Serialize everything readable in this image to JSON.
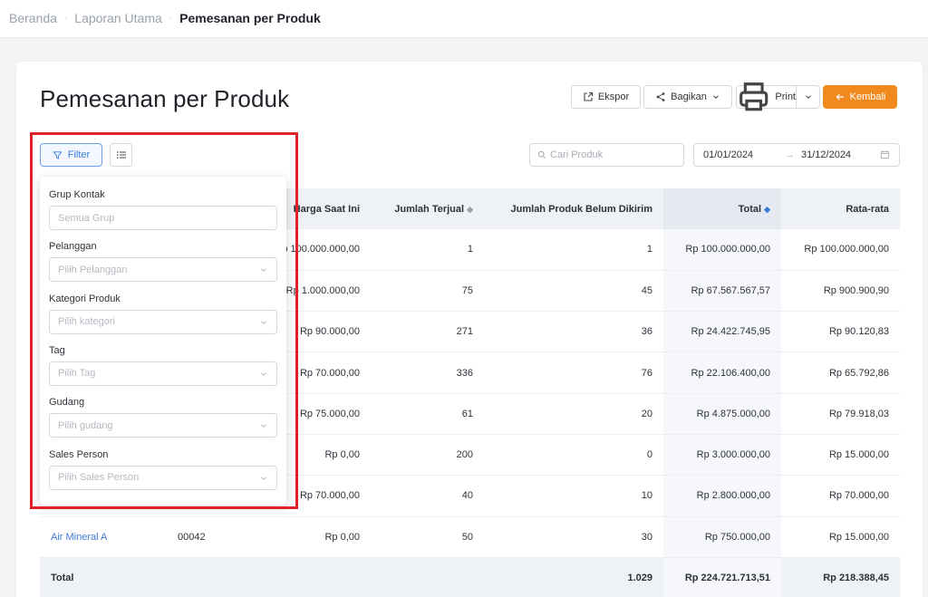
{
  "breadcrumb": {
    "items": [
      "Beranda",
      "Laporan Utama"
    ],
    "current": "Pemesanan per Produk"
  },
  "page": {
    "title": "Pemesanan per Produk"
  },
  "toolbar": {
    "export_label": "Ekspor",
    "share_label": "Bagikan",
    "print_label": "Print",
    "back_label": "Kembali"
  },
  "filter": {
    "button_label": "Filter"
  },
  "search": {
    "placeholder": "Cari Produk"
  },
  "date_range": {
    "start": "01/01/2024",
    "end": "31/12/2024",
    "arrow": "→"
  },
  "table": {
    "headers": {
      "price": "Harga Saat Ini",
      "sold": "Jumlah Terjual",
      "pending": "Jumlah Produk Belum Dikirim",
      "total": "Total",
      "average": "Rata-rata"
    },
    "rows": [
      {
        "name": "",
        "code": "",
        "price": "Rp 100.000.000,00",
        "sold": "1",
        "pending": "1",
        "total": "Rp 100.000.000,00",
        "average": "Rp 100.000.000,00"
      },
      {
        "name": "",
        "code": "",
        "price": "Rp 1.000.000,00",
        "sold": "75",
        "pending": "45",
        "total": "Rp 67.567.567,57",
        "average": "Rp 900.900,90"
      },
      {
        "name": "",
        "code": "",
        "price": "Rp 90.000,00",
        "sold": "271",
        "pending": "36",
        "total": "Rp 24.422.745,95",
        "average": "Rp 90.120,83"
      },
      {
        "name": "",
        "code": "",
        "price": "Rp 70.000,00",
        "sold": "336",
        "pending": "76",
        "total": "Rp 22.106.400,00",
        "average": "Rp 65.792,86"
      },
      {
        "name": "",
        "code": "",
        "price": "Rp 75.000,00",
        "sold": "61",
        "pending": "20",
        "total": "Rp 4.875.000,00",
        "average": "Rp 79.918,03"
      },
      {
        "name": "",
        "code": "",
        "price": "Rp 0,00",
        "sold": "200",
        "pending": "0",
        "total": "Rp 3.000.000,00",
        "average": "Rp 15.000,00"
      },
      {
        "name": "",
        "code": "",
        "price": "Rp 70.000,00",
        "sold": "40",
        "pending": "10",
        "total": "Rp 2.800.000,00",
        "average": "Rp 70.000,00"
      },
      {
        "name": "Air Mineral A",
        "code": "00042",
        "price": "Rp 0,00",
        "sold": "50",
        "pending": "30",
        "total": "Rp 750.000,00",
        "average": "Rp 15.000,00"
      }
    ],
    "footer": {
      "label": "Total",
      "pending": "1.029",
      "total": "Rp 224.721.713,51",
      "average": "Rp 218.388,45"
    }
  },
  "filter_panel": {
    "fields": [
      {
        "label": "Grup Kontak",
        "placeholder": "Semua Grup",
        "dropdown": false
      },
      {
        "label": "Pelanggan",
        "placeholder": "Pilih Pelanggan",
        "dropdown": true
      },
      {
        "label": "Kategori Produk",
        "placeholder": "Pilih kategori",
        "dropdown": true
      },
      {
        "label": "Tag",
        "placeholder": "Pilih Tag",
        "dropdown": true
      },
      {
        "label": "Gudang",
        "placeholder": "Pilih gudang",
        "dropdown": true
      },
      {
        "label": "Sales Person",
        "placeholder": "Pilih Sales Person",
        "dropdown": true
      }
    ]
  },
  "colors": {
    "accent": "#f08a1f",
    "link": "#3d7bd9",
    "highlight": "#e0202a"
  }
}
